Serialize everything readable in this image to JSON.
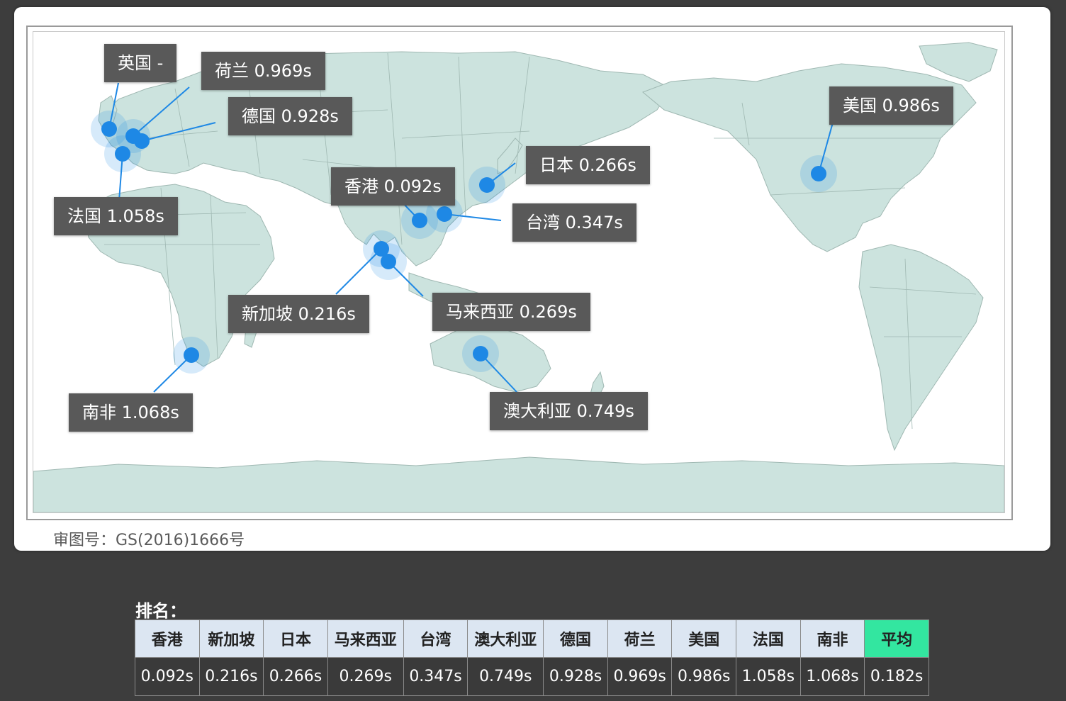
{
  "map": {
    "approval_number": "审图号：GS(2016)1666号",
    "land_color": "#cce3de",
    "border_color": "#9fb8b2",
    "pin_color": "#1e88e5",
    "callout_color": "#595959",
    "locations": [
      {
        "id": "uk",
        "label": "英国 -"
      },
      {
        "id": "nl",
        "label": "荷兰 0.969s"
      },
      {
        "id": "de",
        "label": "德国 0.928s"
      },
      {
        "id": "fr",
        "label": "法国 1.058s"
      },
      {
        "id": "hk",
        "label": "香港 0.092s"
      },
      {
        "id": "jp",
        "label": "日本 0.266s"
      },
      {
        "id": "tw",
        "label": "台湾 0.347s"
      },
      {
        "id": "sg",
        "label": "新加坡 0.216s"
      },
      {
        "id": "my",
        "label": "马来西亚 0.269s"
      },
      {
        "id": "za",
        "label": "南非 1.068s"
      },
      {
        "id": "au",
        "label": "澳大利亚 0.749s"
      },
      {
        "id": "us",
        "label": "美国 0.986s"
      }
    ]
  },
  "ranking": {
    "title": "排名：",
    "headers": [
      "香港",
      "新加坡",
      "日本",
      "马来西亚",
      "台湾",
      "澳大利亚",
      "德国",
      "荷兰",
      "美国",
      "法国",
      "南非",
      "平均"
    ],
    "values": [
      "0.092s",
      "0.216s",
      "0.266s",
      "0.269s",
      "0.347s",
      "0.749s",
      "0.928s",
      "0.969s",
      "0.986s",
      "1.058s",
      "1.068s",
      "0.182s"
    ],
    "highlight_color": "#33e6a0"
  }
}
